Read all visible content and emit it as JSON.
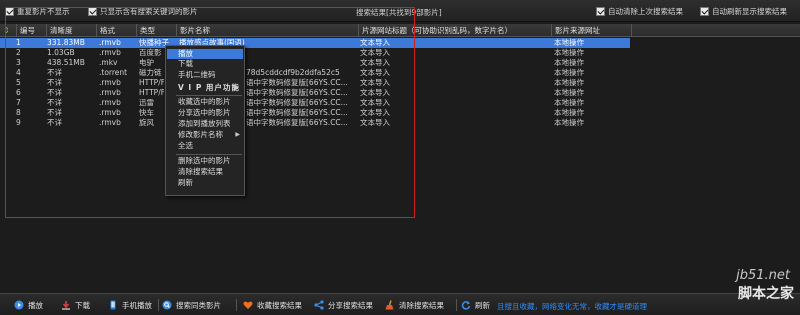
{
  "options": {
    "hide_duplicates": "重复影片不显示",
    "only_keyword": "只显示含有搜索关键词的影片",
    "search_status": "搜索结果[共找到9部影片]",
    "auto_clear": "自动清除上次搜索结果",
    "auto_refresh": "自动刷新显示搜索结果"
  },
  "columns": [
    "编号",
    "清晰度",
    "格式",
    "类型",
    "影片名称",
    "片源网站标题（可协助识别乱码，数字片名）",
    "影片来源网址"
  ],
  "rows": [
    {
      "id": "1",
      "size": "331.83MB",
      "fmt": ".rmvb",
      "type": "快播种子",
      "name": "播放感点故事(国语)",
      "title": "文本导入",
      "source": "本地操作"
    },
    {
      "id": "2",
      "size": "1.03GB",
      "fmt": ".rmvb",
      "type": "百度影",
      "name": "",
      "title": "文本导入",
      "source": "本地操作"
    },
    {
      "id": "3",
      "size": "438.51MB",
      "fmt": ".mkv",
      "type": "电驴",
      "name": "",
      "title": "文本导入",
      "source": "本地操作"
    },
    {
      "id": "4",
      "size": "不详",
      "fmt": ".torrent",
      "type": "磁力链",
      "name": "78d5cddcdf9b2ddfa52c5",
      "title": "文本导入",
      "source": "本地操作"
    },
    {
      "id": "5",
      "size": "不详",
      "fmt": ".rmvb",
      "type": "HTTP/F",
      "name": "语中字数码修复版[66YS.CC...",
      "title": "文本导入",
      "source": "本地操作"
    },
    {
      "id": "6",
      "size": "不详",
      "fmt": ".rmvb",
      "type": "HTTP/F",
      "name": "语中字数码修复版[66YS.CC...",
      "title": "文本导入",
      "source": "本地操作"
    },
    {
      "id": "7",
      "size": "不详",
      "fmt": ".rmvb",
      "type": "迅雷",
      "name": "语中字数码修复版[66YS.CC...",
      "title": "文本导入",
      "source": "本地操作"
    },
    {
      "id": "8",
      "size": "不详",
      "fmt": ".rmvb",
      "type": "快车",
      "name": "语中字数码修复版[66YS.CC...",
      "title": "文本导入",
      "source": "本地操作"
    },
    {
      "id": "9",
      "size": "不详",
      "fmt": ".rmvb",
      "type": "旋风",
      "name": "语中字数码修复版[66YS.CC...",
      "title": "文本导入",
      "source": "本地操作"
    }
  ],
  "context_menu": {
    "play": "播放",
    "download": "下载",
    "qr": "手机二维码",
    "vip": "V I P 用户功能",
    "collect": "收藏选中的影片",
    "share": "分享选中的影片",
    "playlist": "添加到播放列表",
    "rename": "修改影片名称",
    "select_all": "全选",
    "delete": "删除选中的影片",
    "clear": "清除搜索结果",
    "refresh": "刷新"
  },
  "toolbar": {
    "play": "播放",
    "download": "下载",
    "mobile": "手机播放",
    "search_similar": "搜索同类影片",
    "collect_results": "收藏搜索结果",
    "share_results": "分享搜索结果",
    "clear_results": "清除搜索结果",
    "refresh": "刷新",
    "notice": "且搜且收藏，网络变化无常，收藏才是硬道理"
  },
  "watermark": {
    "site": "jb51.net",
    "name": "脚本之家"
  },
  "colors": {
    "selection": "#3d79d8",
    "highlight_box": "#d02020",
    "notice": "#2d8cff"
  }
}
